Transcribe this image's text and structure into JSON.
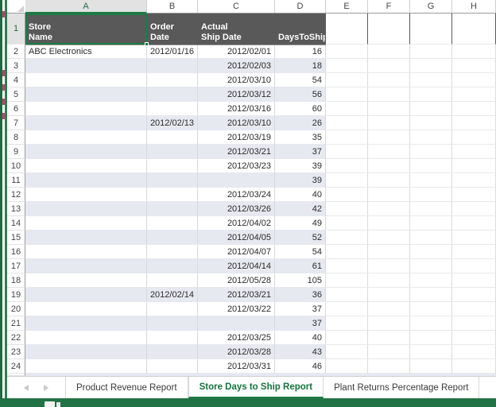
{
  "app": {
    "name": "Excel Worksheet",
    "accent_color": "#217346",
    "selection_color": "#1d7b45",
    "header_fill": "#595959",
    "band_fill": "#e7e9f0"
  },
  "grid": {
    "column_letters": [
      "A",
      "B",
      "C",
      "D",
      "E",
      "F",
      "G",
      "H"
    ],
    "selected_column": "A",
    "selected_cell": "A1",
    "row_numbers": [
      1,
      2,
      3,
      4,
      5,
      6,
      7,
      8,
      9,
      10,
      11,
      12,
      13,
      14,
      15,
      16,
      17,
      18,
      19,
      20,
      21,
      22,
      23,
      24
    ],
    "selected_row": 1,
    "headers": {
      "a": [
        "Store",
        "Name"
      ],
      "b": [
        "Order",
        "Date"
      ],
      "c": [
        "Actual",
        "Ship Date"
      ],
      "d": [
        "",
        "DaysToShip"
      ]
    },
    "rows": [
      {
        "n": 2,
        "a": "ABC Electronics",
        "b": "2012/01/16",
        "c": "2012/02/01",
        "d": "16"
      },
      {
        "n": 3,
        "a": "",
        "b": "",
        "c": "2012/02/03",
        "d": "18"
      },
      {
        "n": 4,
        "a": "",
        "b": "",
        "c": "2012/03/10",
        "d": "54"
      },
      {
        "n": 5,
        "a": "",
        "b": "",
        "c": "2012/03/12",
        "d": "56"
      },
      {
        "n": 6,
        "a": "",
        "b": "",
        "c": "2012/03/16",
        "d": "60"
      },
      {
        "n": 7,
        "a": "",
        "b": "2012/02/13",
        "c": "2012/03/10",
        "d": "26"
      },
      {
        "n": 8,
        "a": "",
        "b": "",
        "c": "2012/03/19",
        "d": "35"
      },
      {
        "n": 9,
        "a": "",
        "b": "",
        "c": "2012/03/21",
        "d": "37"
      },
      {
        "n": 10,
        "a": "",
        "b": "",
        "c": "2012/03/23",
        "d": "39"
      },
      {
        "n": 11,
        "a": "",
        "b": "",
        "c": "",
        "d": "39"
      },
      {
        "n": 12,
        "a": "",
        "b": "",
        "c": "2012/03/24",
        "d": "40"
      },
      {
        "n": 13,
        "a": "",
        "b": "",
        "c": "2012/03/26",
        "d": "42"
      },
      {
        "n": 14,
        "a": "",
        "b": "",
        "c": "2012/04/02",
        "d": "49"
      },
      {
        "n": 15,
        "a": "",
        "b": "",
        "c": "2012/04/05",
        "d": "52"
      },
      {
        "n": 16,
        "a": "",
        "b": "",
        "c": "2012/04/07",
        "d": "54"
      },
      {
        "n": 17,
        "a": "",
        "b": "",
        "c": "2012/04/14",
        "d": "61"
      },
      {
        "n": 18,
        "a": "",
        "b": "",
        "c": "2012/05/28",
        "d": "105"
      },
      {
        "n": 19,
        "a": "",
        "b": "2012/02/14",
        "c": "2012/03/21",
        "d": "36"
      },
      {
        "n": 20,
        "a": "",
        "b": "",
        "c": "2012/03/22",
        "d": "37"
      },
      {
        "n": 21,
        "a": "",
        "b": "",
        "c": "",
        "d": "37"
      },
      {
        "n": 22,
        "a": "",
        "b": "",
        "c": "2012/03/25",
        "d": "40"
      },
      {
        "n": 23,
        "a": "",
        "b": "",
        "c": "2012/03/28",
        "d": "43"
      },
      {
        "n": 24,
        "a": "",
        "b": "",
        "c": "2012/03/31",
        "d": "46"
      }
    ]
  },
  "tabbar": {
    "prev_icon": "triangle-left-icon",
    "next_icon": "triangle-right-icon",
    "tabs": [
      {
        "label": "Product Revenue Report",
        "active": false
      },
      {
        "label": "Store Days to Ship Report",
        "active": true
      },
      {
        "label": "Plant Returns Percentage Report",
        "active": false
      }
    ]
  }
}
